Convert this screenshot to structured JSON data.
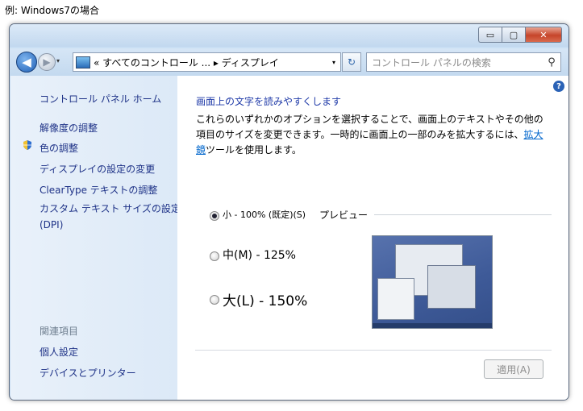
{
  "caption": "例: Windows7の場合",
  "window": {
    "minimize_glyph": "▭",
    "maximize_glyph": "▢",
    "close_glyph": "✕"
  },
  "nav": {
    "back_glyph": "◀",
    "forward_glyph": "▶",
    "dropdown_glyph": "▾",
    "address": "« すべてのコントロール ... ▸ ディスプレイ",
    "address_dropdown_glyph": "▾",
    "refresh_glyph": "↻",
    "search_placeholder": "コントロール パネルの検索",
    "search_icon_glyph": "⚲"
  },
  "sidebar": {
    "home": "コントロール パネル ホーム",
    "items": [
      "解像度の調整",
      "色の調整",
      "ディスプレイの設定の変更",
      "ClearType テキストの調整",
      "カスタム テキスト サイズの設定 (DPI)"
    ],
    "related_header": "関連項目",
    "related": [
      "個人設定",
      "デバイスとプリンター"
    ]
  },
  "main": {
    "help_glyph": "?",
    "heading": "画面上の文字を読みやすくします",
    "description": "これらのいずれかのオプションを選択することで、画面上のテキストやその他の項目のサイズを変更できます。一時的に画面上の一部のみを拡大するには、",
    "link": "拡大鏡",
    "description_tail": "ツールを使用します。",
    "options": [
      {
        "label": "小 - 100% (既定)(S)",
        "selected": true
      },
      {
        "label": "中(M) - 125%",
        "selected": false
      },
      {
        "label": "大(L) - 150%",
        "selected": false
      }
    ],
    "preview_label": "プレビュー",
    "apply": "適用(A)"
  },
  "colors": {
    "link": "#1e3287",
    "heading": "#1f3aa8",
    "close_button": "#c6452a"
  }
}
